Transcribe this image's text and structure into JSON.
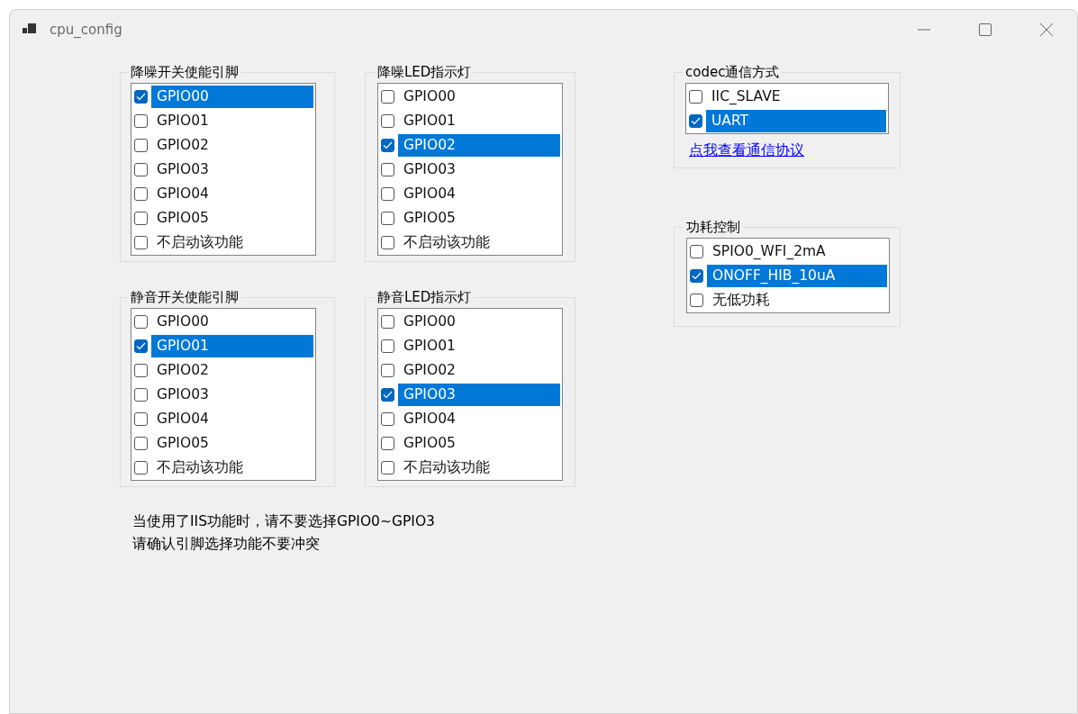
{
  "window": {
    "title": "cpu_config"
  },
  "groups": [
    {
      "title": "降噪开关使能引脚",
      "items": [
        {
          "label": "GPIO00",
          "checked": true,
          "selected": true
        },
        {
          "label": "GPIO01",
          "checked": false,
          "selected": false
        },
        {
          "label": "GPIO02",
          "checked": false,
          "selected": false
        },
        {
          "label": "GPIO03",
          "checked": false,
          "selected": false
        },
        {
          "label": "GPIO04",
          "checked": false,
          "selected": false
        },
        {
          "label": "GPIO05",
          "checked": false,
          "selected": false
        },
        {
          "label": "不启动该功能",
          "checked": false,
          "selected": false
        }
      ]
    },
    {
      "title": "降噪LED指示灯",
      "items": [
        {
          "label": "GPIO00",
          "checked": false,
          "selected": false
        },
        {
          "label": "GPIO01",
          "checked": false,
          "selected": false
        },
        {
          "label": "GPIO02",
          "checked": true,
          "selected": true
        },
        {
          "label": "GPIO03",
          "checked": false,
          "selected": false
        },
        {
          "label": "GPIO04",
          "checked": false,
          "selected": false
        },
        {
          "label": "GPIO05",
          "checked": false,
          "selected": false
        },
        {
          "label": "不启动该功能",
          "checked": false,
          "selected": false
        }
      ]
    },
    {
      "title": "静音开关使能引脚",
      "items": [
        {
          "label": "GPIO00",
          "checked": false,
          "selected": false
        },
        {
          "label": "GPIO01",
          "checked": true,
          "selected": true
        },
        {
          "label": "GPIO02",
          "checked": false,
          "selected": false
        },
        {
          "label": "GPIO03",
          "checked": false,
          "selected": false
        },
        {
          "label": "GPIO04",
          "checked": false,
          "selected": false
        },
        {
          "label": "GPIO05",
          "checked": false,
          "selected": false
        },
        {
          "label": "不启动该功能",
          "checked": false,
          "selected": false
        }
      ]
    },
    {
      "title": "静音LED指示灯",
      "items": [
        {
          "label": "GPIO00",
          "checked": false,
          "selected": false
        },
        {
          "label": "GPIO01",
          "checked": false,
          "selected": false
        },
        {
          "label": "GPIO02",
          "checked": false,
          "selected": false
        },
        {
          "label": "GPIO03",
          "checked": true,
          "selected": true
        },
        {
          "label": "GPIO04",
          "checked": false,
          "selected": false
        },
        {
          "label": "GPIO05",
          "checked": false,
          "selected": false
        },
        {
          "label": "不启动该功能",
          "checked": false,
          "selected": false
        }
      ]
    }
  ],
  "notes": [
    "当使用了IIS功能时，请不要选择GPIO0~GPIO3",
    "请确认引脚选择功能不要冲突"
  ],
  "codec": {
    "title": "codec通信方式",
    "items": [
      {
        "label": "IIC_SLAVE",
        "checked": false,
        "selected": false
      },
      {
        "label": "UART",
        "checked": true,
        "selected": true
      }
    ],
    "link": "点我查看通信协议"
  },
  "power": {
    "title": "功耗控制",
    "items": [
      {
        "label": "SPIO0_WFI_2mA",
        "checked": false,
        "selected": false
      },
      {
        "label": "ONOFF_HIB_10uA",
        "checked": true,
        "selected": true
      },
      {
        "label": "无低功耗",
        "checked": false,
        "selected": false
      }
    ]
  }
}
